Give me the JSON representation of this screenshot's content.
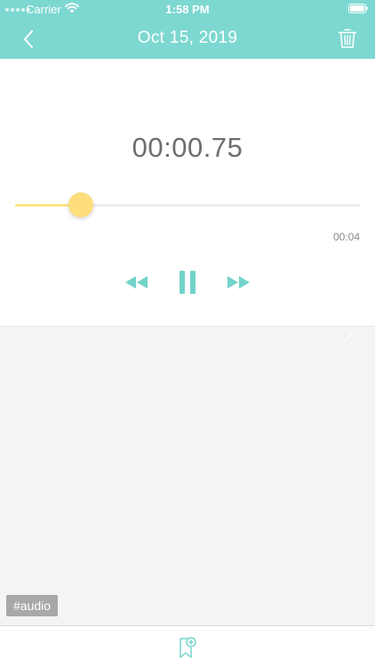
{
  "colors": {
    "header_bg": "#7dd8d1",
    "accent": "#72d3cb",
    "slider_thumb": "#fede7a",
    "slider_fill": "#fde385",
    "notes_bg": "#f4f4f4",
    "tag_bg": "#a8a8a8"
  },
  "status_bar": {
    "carrier": "Carrier",
    "time": "1:58 PM"
  },
  "nav": {
    "title": "Oct 15, 2019",
    "back_icon": "chevron-left-icon",
    "trash_icon": "trash-icon"
  },
  "player": {
    "elapsed": "00:00.75",
    "duration": "00:04",
    "progress": 0.19,
    "rewind_icon": "rewind-icon",
    "pause_icon": "pause-icon",
    "forward_icon": "fast-forward-icon"
  },
  "notes": {
    "tag": "#audio"
  },
  "toolbar": {
    "bookmark_icon": "bookmark-add-icon"
  }
}
